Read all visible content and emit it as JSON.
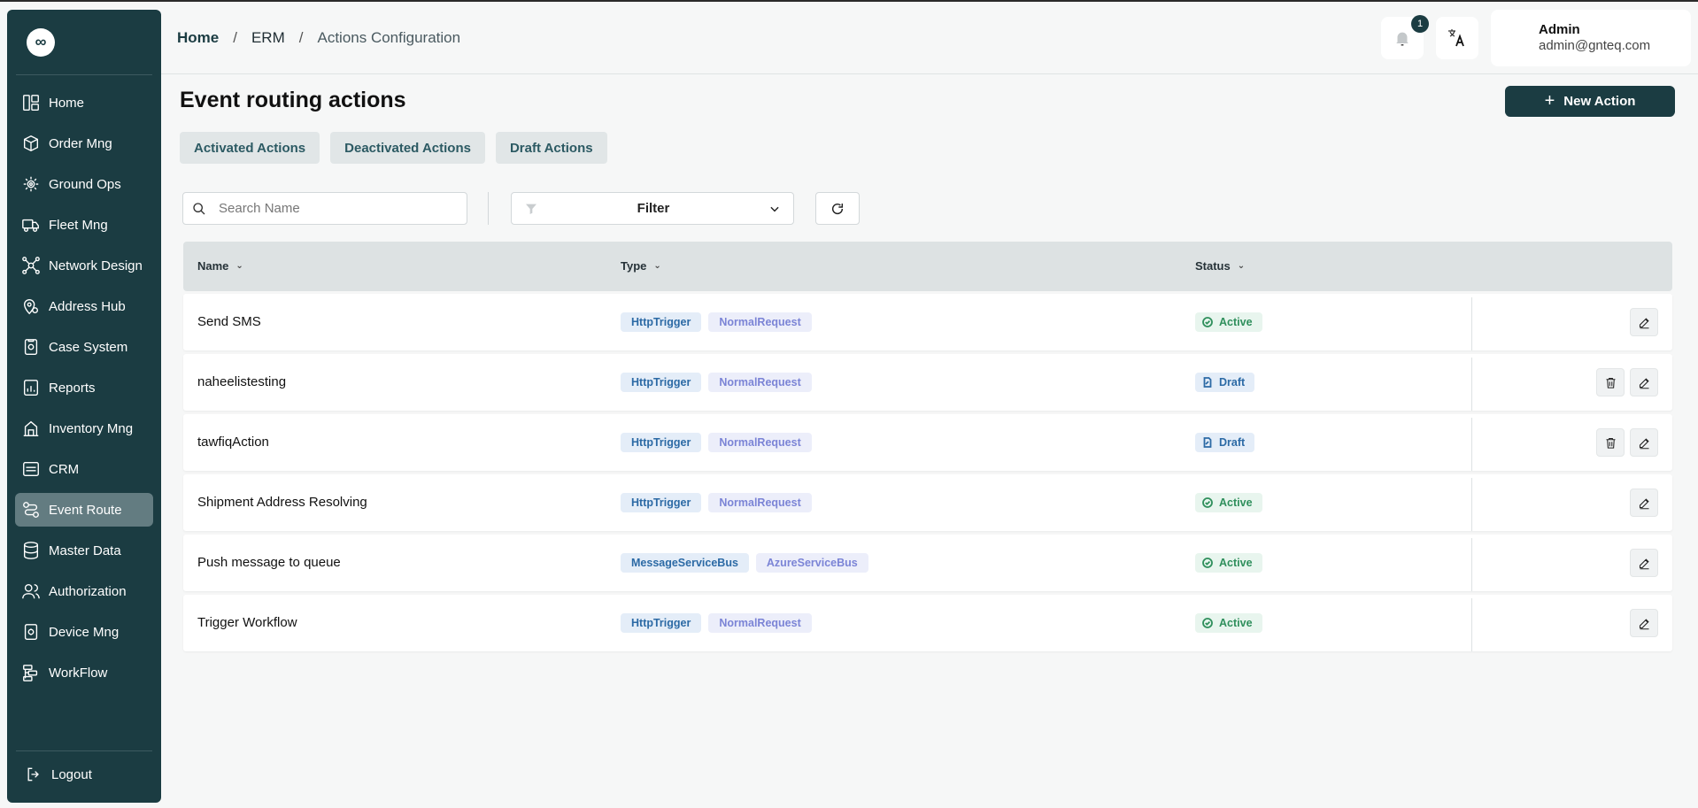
{
  "sidebar": {
    "logo_glyph": "∞",
    "items": [
      {
        "label": "Home",
        "icon": "home-icon"
      },
      {
        "label": "Order Mng",
        "icon": "order-icon"
      },
      {
        "label": "Ground Ops",
        "icon": "ground-ops-icon"
      },
      {
        "label": "Fleet Mng",
        "icon": "truck-icon"
      },
      {
        "label": "Network Design",
        "icon": "network-icon"
      },
      {
        "label": "Address Hub",
        "icon": "location-icon"
      },
      {
        "label": "Case System",
        "icon": "case-icon"
      },
      {
        "label": "Reports",
        "icon": "reports-icon"
      },
      {
        "label": "Inventory Mng",
        "icon": "inventory-icon"
      },
      {
        "label": "CRM",
        "icon": "crm-icon"
      },
      {
        "label": "Event Route",
        "icon": "route-icon",
        "active": true
      },
      {
        "label": "Master Data",
        "icon": "database-icon"
      },
      {
        "label": "Authorization",
        "icon": "users-icon"
      },
      {
        "label": "Device Mng",
        "icon": "device-icon"
      },
      {
        "label": "WorkFlow",
        "icon": "workflow-icon"
      }
    ],
    "logout_label": "Logout"
  },
  "header": {
    "breadcrumb": {
      "home": "Home",
      "erm": "ERM",
      "current": "Actions Configuration"
    },
    "notification_count": "1",
    "user": {
      "name": "Admin",
      "email": "admin@gnteq.com"
    }
  },
  "main": {
    "title": "Event routing actions",
    "new_button": "New Action",
    "tabs": [
      "Activated Actions",
      "Deactivated Actions",
      "Draft Actions"
    ],
    "search_placeholder": "Search Name",
    "filter_label": "Filter"
  },
  "table": {
    "columns": [
      "Name",
      "Type",
      "Status"
    ],
    "rows": [
      {
        "name": "Send SMS",
        "type1": "HttpTrigger",
        "type2": "NormalRequest",
        "status": "Active",
        "deletable": false
      },
      {
        "name": "naheelistesting",
        "type1": "HttpTrigger",
        "type2": "NormalRequest",
        "status": "Draft",
        "deletable": true
      },
      {
        "name": "tawfiqAction",
        "type1": "HttpTrigger",
        "type2": "NormalRequest",
        "status": "Draft",
        "deletable": true
      },
      {
        "name": "Shipment Address Resolving",
        "type1": "HttpTrigger",
        "type2": "NormalRequest",
        "status": "Active",
        "deletable": false
      },
      {
        "name": "Push message to queue",
        "type1": "MessageServiceBus",
        "type2": "AzureServiceBus",
        "status": "Active",
        "deletable": false
      },
      {
        "name": "Trigger Workflow",
        "type1": "HttpTrigger",
        "type2": "NormalRequest",
        "status": "Active",
        "deletable": false
      }
    ]
  }
}
